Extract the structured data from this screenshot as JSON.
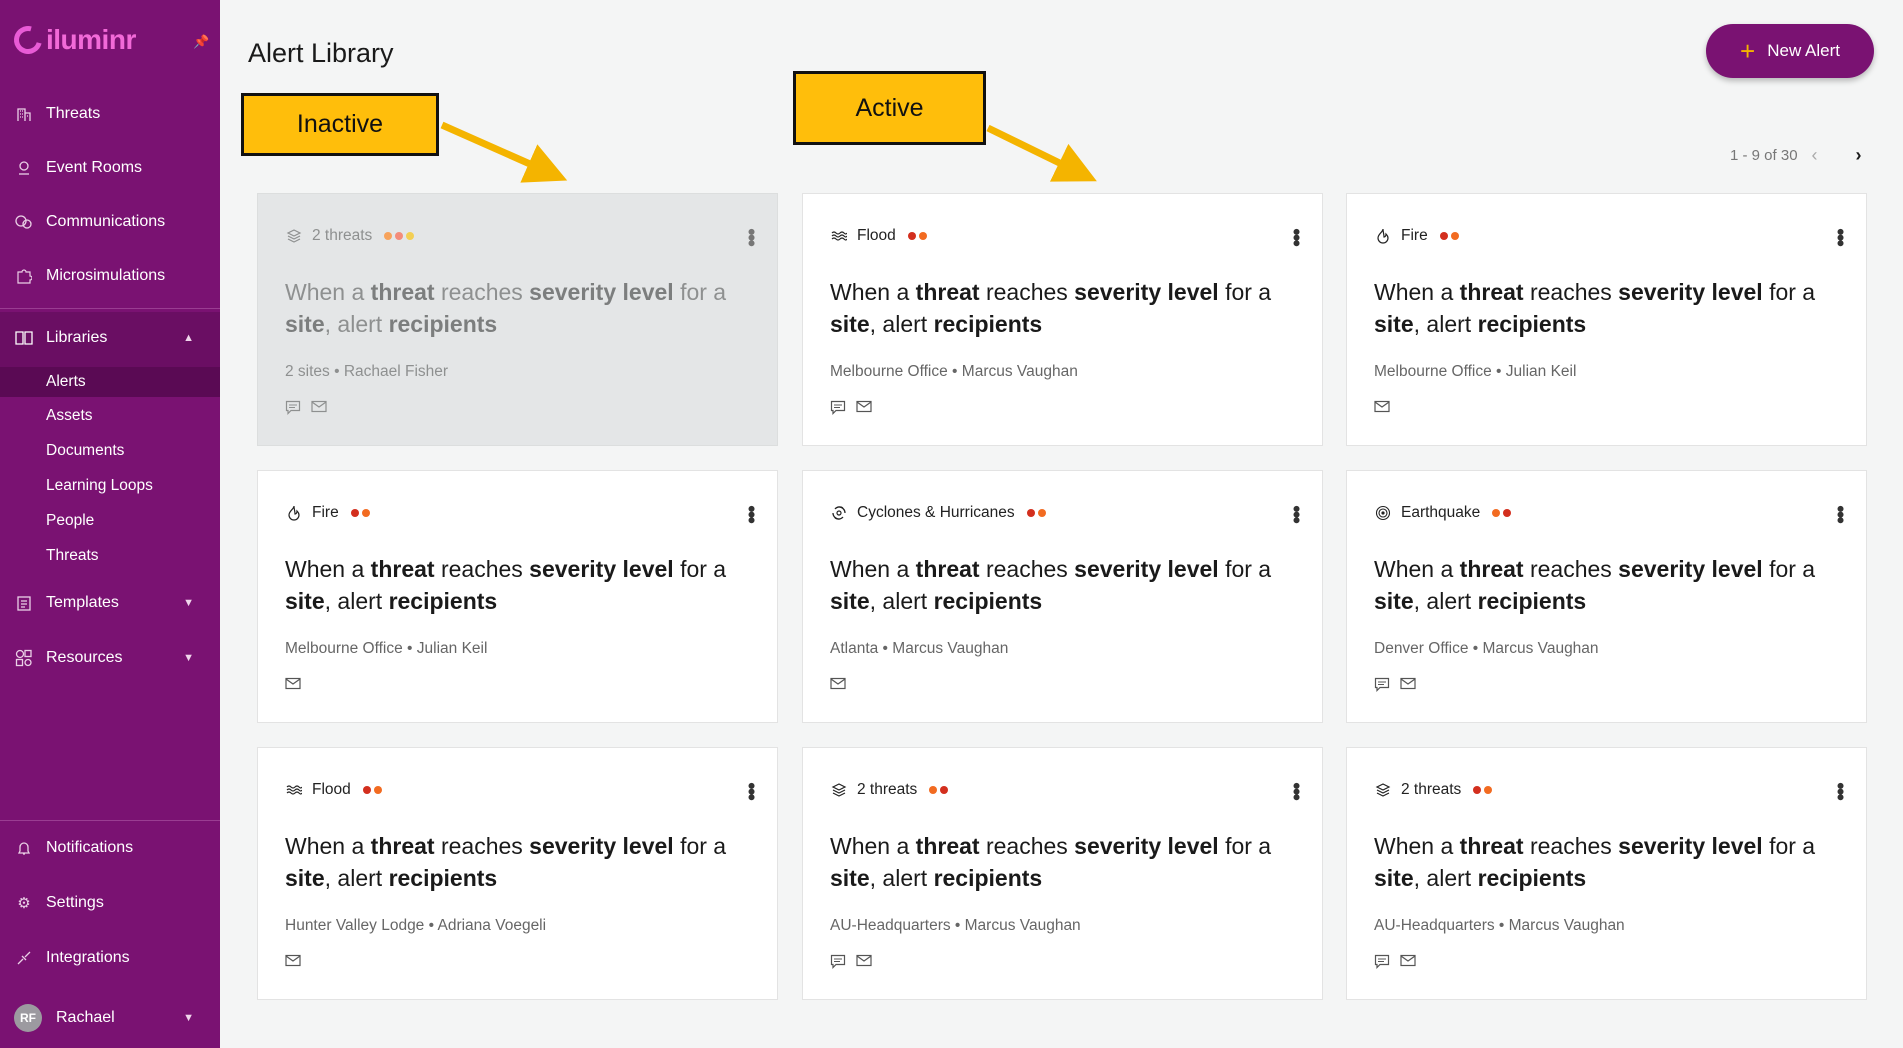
{
  "app": {
    "logo": "iluminr"
  },
  "sidebar": {
    "items": [
      {
        "label": "Threats",
        "icon": "building-icon"
      },
      {
        "label": "Event Rooms",
        "icon": "location-pin-icon"
      },
      {
        "label": "Communications",
        "icon": "chat-bubbles-icon"
      },
      {
        "label": "Microsimulations",
        "icon": "puzzle-icon"
      }
    ],
    "libraries": {
      "label": "Libraries",
      "icon": "book-icon",
      "subitems": [
        "Alerts",
        "Assets",
        "Documents",
        "Learning Loops",
        "People",
        "Threats"
      ],
      "active": "Alerts"
    },
    "templates_label": "Templates",
    "resources_label": "Resources",
    "bottom": [
      {
        "label": "Notifications",
        "icon": "bell-icon"
      },
      {
        "label": "Settings",
        "icon": "gear-icon"
      },
      {
        "label": "Integrations",
        "icon": "link-icon"
      }
    ],
    "user": {
      "initials": "RF",
      "name": "Rachael"
    }
  },
  "header": {
    "title": "Alert Library",
    "new_alert_label": "New Alert"
  },
  "pagination": {
    "text": "1 - 9 of 30"
  },
  "annotations": {
    "inactive_label": "Inactive",
    "active_label": "Active"
  },
  "colors": {
    "brand": "#7a1272",
    "accent": "#f4b400",
    "callout": "#ffbe0b",
    "severity_red": "#d32f1e",
    "severity_orange": "#f26b21",
    "severity_yellow": "#f5c518"
  },
  "alert_description": {
    "p1": "When a ",
    "b1": "threat",
    "p2": " reaches ",
    "b2": "severity level",
    "p3": " for a ",
    "b3": "site",
    "p4": ", alert ",
    "b4": "recipients"
  },
  "alerts": [
    {
      "type": "2 threats",
      "type_icon": "layers-icon",
      "severity": [
        "#f7a35c",
        "#f48c7a",
        "#f3cf54"
      ],
      "sub": "2 sites • Rachael Fisher",
      "channels": [
        "sms-icon",
        "email-icon"
      ],
      "inactive": true
    },
    {
      "type": "Flood",
      "type_icon": "waves-icon",
      "severity": [
        "#d32f1e",
        "#f26b21"
      ],
      "sub": "Melbourne Office • Marcus Vaughan",
      "channels": [
        "sms-icon",
        "email-icon"
      ],
      "inactive": false
    },
    {
      "type": "Fire",
      "type_icon": "flame-icon",
      "severity": [
        "#d32f1e",
        "#f26b21"
      ],
      "sub": "Melbourne Office • Julian Keil",
      "channels": [
        "email-icon"
      ],
      "inactive": false
    },
    {
      "type": "Fire",
      "type_icon": "flame-icon",
      "severity": [
        "#d32f1e",
        "#f26b21"
      ],
      "sub": "Melbourne Office • Julian Keil",
      "channels": [
        "email-icon"
      ],
      "inactive": false
    },
    {
      "type": "Cyclones & Hurricanes",
      "type_icon": "cyclone-icon",
      "severity": [
        "#d32f1e",
        "#f26b21"
      ],
      "sub": "Atlanta • Marcus Vaughan",
      "channels": [
        "email-icon"
      ],
      "inactive": false
    },
    {
      "type": "Earthquake",
      "type_icon": "target-icon",
      "severity": [
        "#f26b21",
        "#d32f1e"
      ],
      "sub": "Denver Office • Marcus Vaughan",
      "channels": [
        "sms-icon",
        "email-icon"
      ],
      "inactive": false
    },
    {
      "type": "Flood",
      "type_icon": "waves-icon",
      "severity": [
        "#d32f1e",
        "#f26b21"
      ],
      "sub": "Hunter Valley Lodge • Adriana Voegeli",
      "channels": [
        "email-icon"
      ],
      "inactive": false
    },
    {
      "type": "2 threats",
      "type_icon": "layers-icon",
      "severity": [
        "#f26b21",
        "#d32f1e"
      ],
      "sub": "AU-Headquarters • Marcus Vaughan",
      "channels": [
        "sms-icon",
        "email-icon"
      ],
      "inactive": false
    },
    {
      "type": "2 threats",
      "type_icon": "layers-icon",
      "severity": [
        "#d32f1e",
        "#f26b21"
      ],
      "sub": "AU-Headquarters • Marcus Vaughan",
      "channels": [
        "sms-icon",
        "email-icon"
      ],
      "inactive": false
    }
  ]
}
